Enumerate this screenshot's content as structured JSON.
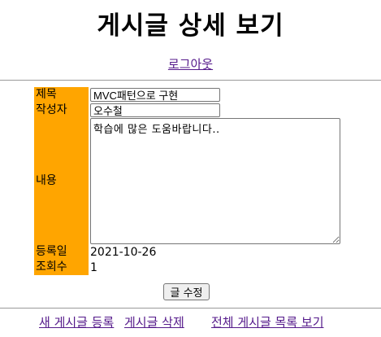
{
  "page": {
    "title": "게시글 상세 보기"
  },
  "header": {
    "logout_link": "로그아웃"
  },
  "form": {
    "fields": [
      {
        "label": "제목",
        "value": "MVC패턴으로 구현"
      },
      {
        "label": "작성자",
        "value": "오수철"
      },
      {
        "label": "내용",
        "value": "학습에 많은 도움바랍니다.."
      },
      {
        "label": "등록일",
        "value": "2021-10-26"
      },
      {
        "label": "조회수",
        "value": "1"
      }
    ],
    "submit_label": "글 수정"
  },
  "footer": {
    "links": [
      {
        "label": "새 게시글 등록"
      },
      {
        "label": "게시글 삭제"
      },
      {
        "label": "전체 게시글 목록 보기"
      }
    ]
  },
  "colors": {
    "label_bg": "#ffa500",
    "link": "#551a8b"
  }
}
